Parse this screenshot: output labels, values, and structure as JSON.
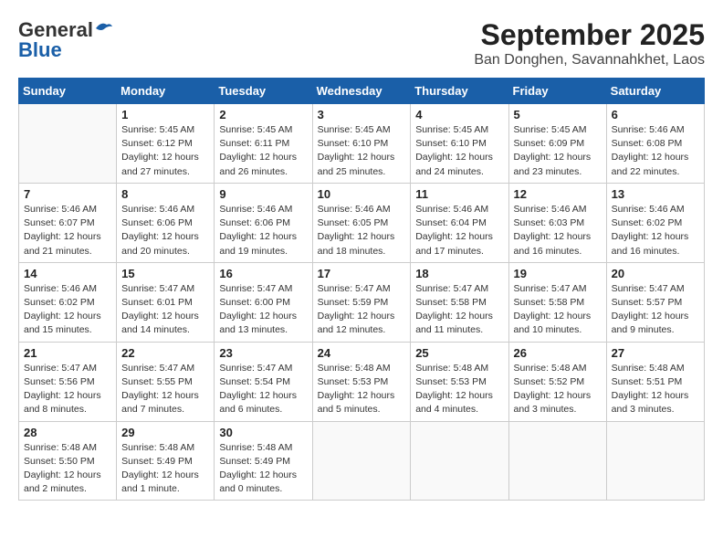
{
  "header": {
    "logo_line1": "General",
    "logo_line2": "Blue",
    "title": "September 2025",
    "subtitle": "Ban Donghen, Savannahkhet, Laos"
  },
  "calendar": {
    "days_of_week": [
      "Sunday",
      "Monday",
      "Tuesday",
      "Wednesday",
      "Thursday",
      "Friday",
      "Saturday"
    ],
    "weeks": [
      [
        {
          "num": "",
          "info": ""
        },
        {
          "num": "1",
          "info": "Sunrise: 5:45 AM\nSunset: 6:12 PM\nDaylight: 12 hours\nand 27 minutes."
        },
        {
          "num": "2",
          "info": "Sunrise: 5:45 AM\nSunset: 6:11 PM\nDaylight: 12 hours\nand 26 minutes."
        },
        {
          "num": "3",
          "info": "Sunrise: 5:45 AM\nSunset: 6:10 PM\nDaylight: 12 hours\nand 25 minutes."
        },
        {
          "num": "4",
          "info": "Sunrise: 5:45 AM\nSunset: 6:10 PM\nDaylight: 12 hours\nand 24 minutes."
        },
        {
          "num": "5",
          "info": "Sunrise: 5:45 AM\nSunset: 6:09 PM\nDaylight: 12 hours\nand 23 minutes."
        },
        {
          "num": "6",
          "info": "Sunrise: 5:46 AM\nSunset: 6:08 PM\nDaylight: 12 hours\nand 22 minutes."
        }
      ],
      [
        {
          "num": "7",
          "info": "Sunrise: 5:46 AM\nSunset: 6:07 PM\nDaylight: 12 hours\nand 21 minutes."
        },
        {
          "num": "8",
          "info": "Sunrise: 5:46 AM\nSunset: 6:06 PM\nDaylight: 12 hours\nand 20 minutes."
        },
        {
          "num": "9",
          "info": "Sunrise: 5:46 AM\nSunset: 6:06 PM\nDaylight: 12 hours\nand 19 minutes."
        },
        {
          "num": "10",
          "info": "Sunrise: 5:46 AM\nSunset: 6:05 PM\nDaylight: 12 hours\nand 18 minutes."
        },
        {
          "num": "11",
          "info": "Sunrise: 5:46 AM\nSunset: 6:04 PM\nDaylight: 12 hours\nand 17 minutes."
        },
        {
          "num": "12",
          "info": "Sunrise: 5:46 AM\nSunset: 6:03 PM\nDaylight: 12 hours\nand 16 minutes."
        },
        {
          "num": "13",
          "info": "Sunrise: 5:46 AM\nSunset: 6:02 PM\nDaylight: 12 hours\nand 16 minutes."
        }
      ],
      [
        {
          "num": "14",
          "info": "Sunrise: 5:46 AM\nSunset: 6:02 PM\nDaylight: 12 hours\nand 15 minutes."
        },
        {
          "num": "15",
          "info": "Sunrise: 5:47 AM\nSunset: 6:01 PM\nDaylight: 12 hours\nand 14 minutes."
        },
        {
          "num": "16",
          "info": "Sunrise: 5:47 AM\nSunset: 6:00 PM\nDaylight: 12 hours\nand 13 minutes."
        },
        {
          "num": "17",
          "info": "Sunrise: 5:47 AM\nSunset: 5:59 PM\nDaylight: 12 hours\nand 12 minutes."
        },
        {
          "num": "18",
          "info": "Sunrise: 5:47 AM\nSunset: 5:58 PM\nDaylight: 12 hours\nand 11 minutes."
        },
        {
          "num": "19",
          "info": "Sunrise: 5:47 AM\nSunset: 5:58 PM\nDaylight: 12 hours\nand 10 minutes."
        },
        {
          "num": "20",
          "info": "Sunrise: 5:47 AM\nSunset: 5:57 PM\nDaylight: 12 hours\nand 9 minutes."
        }
      ],
      [
        {
          "num": "21",
          "info": "Sunrise: 5:47 AM\nSunset: 5:56 PM\nDaylight: 12 hours\nand 8 minutes."
        },
        {
          "num": "22",
          "info": "Sunrise: 5:47 AM\nSunset: 5:55 PM\nDaylight: 12 hours\nand 7 minutes."
        },
        {
          "num": "23",
          "info": "Sunrise: 5:47 AM\nSunset: 5:54 PM\nDaylight: 12 hours\nand 6 minutes."
        },
        {
          "num": "24",
          "info": "Sunrise: 5:48 AM\nSunset: 5:53 PM\nDaylight: 12 hours\nand 5 minutes."
        },
        {
          "num": "25",
          "info": "Sunrise: 5:48 AM\nSunset: 5:53 PM\nDaylight: 12 hours\nand 4 minutes."
        },
        {
          "num": "26",
          "info": "Sunrise: 5:48 AM\nSunset: 5:52 PM\nDaylight: 12 hours\nand 3 minutes."
        },
        {
          "num": "27",
          "info": "Sunrise: 5:48 AM\nSunset: 5:51 PM\nDaylight: 12 hours\nand 3 minutes."
        }
      ],
      [
        {
          "num": "28",
          "info": "Sunrise: 5:48 AM\nSunset: 5:50 PM\nDaylight: 12 hours\nand 2 minutes."
        },
        {
          "num": "29",
          "info": "Sunrise: 5:48 AM\nSunset: 5:49 PM\nDaylight: 12 hours\nand 1 minute."
        },
        {
          "num": "30",
          "info": "Sunrise: 5:48 AM\nSunset: 5:49 PM\nDaylight: 12 hours\nand 0 minutes."
        },
        {
          "num": "",
          "info": ""
        },
        {
          "num": "",
          "info": ""
        },
        {
          "num": "",
          "info": ""
        },
        {
          "num": "",
          "info": ""
        }
      ]
    ]
  }
}
